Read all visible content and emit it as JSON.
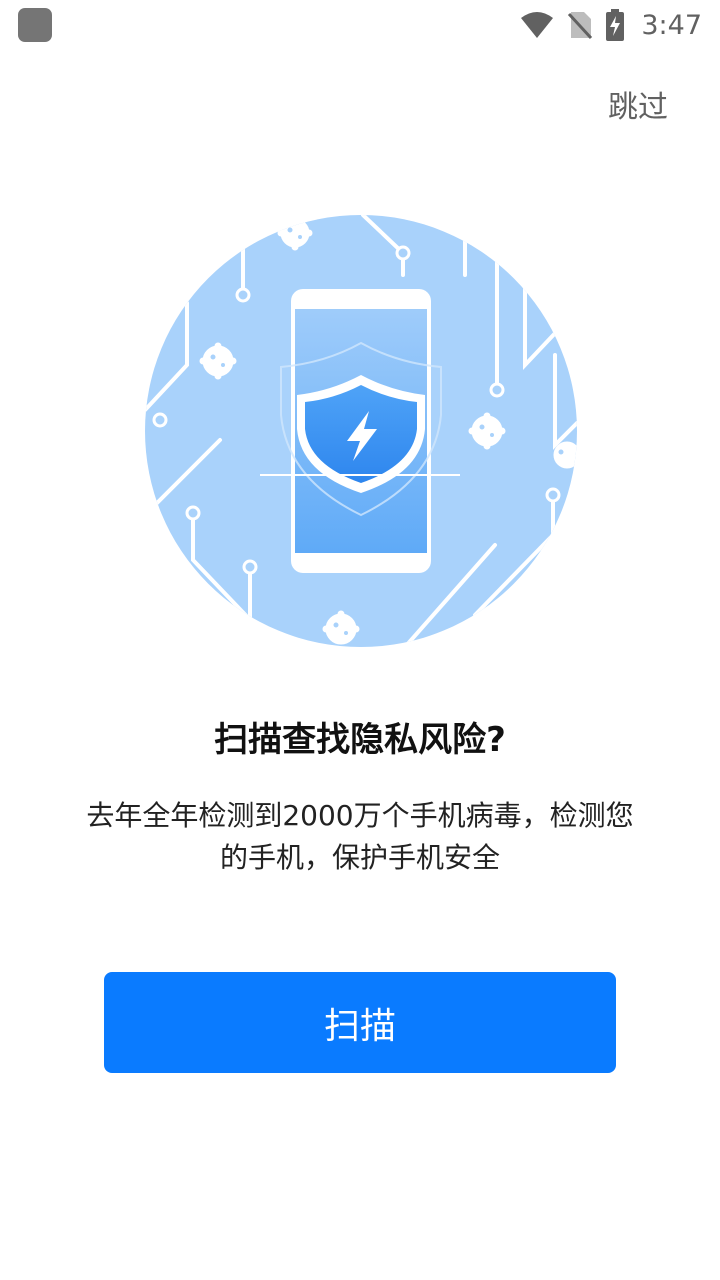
{
  "status_bar": {
    "time": "3:47",
    "icons": [
      "app-notification-icon",
      "wifi-icon",
      "no-sim-icon",
      "battery-charging-icon"
    ]
  },
  "header": {
    "skip_label": "跳过"
  },
  "hero": {
    "illustration": "phone-shield-scan-illustration"
  },
  "content": {
    "title": "扫描查找隐私风险?",
    "description": "去年全年检测到2000万个手机病毒，检测您的手机，保护手机安全"
  },
  "actions": {
    "scan_label": "扫描"
  },
  "colors": {
    "primary": "#0A7BFF",
    "circle": "#A9D2FB",
    "shield": "#3E97F5"
  }
}
